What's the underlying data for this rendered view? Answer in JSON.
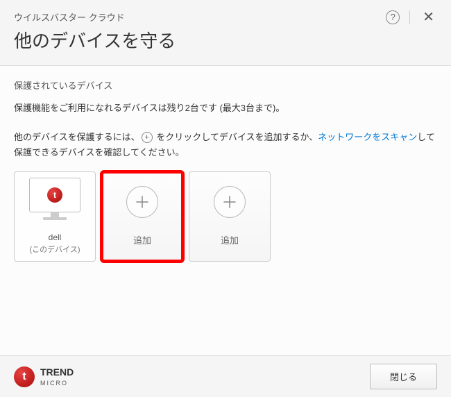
{
  "header": {
    "subtitle": "ウイルスバスター クラウド",
    "title": "他のデバイスを守る"
  },
  "content": {
    "sectionLabel": "保護されているデバイス",
    "infoText": "保護機能をご利用になれるデバイスは残り2台です (最大3台まで)。",
    "instruction": {
      "part1": "他のデバイスを保護するには、",
      "part2": " をクリックしてデバイスを追加するか、",
      "linkText": "ネットワークをスキャン",
      "part3": "して保護できるデバイスを確認してください。"
    }
  },
  "devices": {
    "current": {
      "name": "dell",
      "label": "(このデバイス)"
    },
    "addLabel": "追加"
  },
  "footer": {
    "brandName": "TREND",
    "brandSub": "MICRO",
    "closeLabel": "閉じる"
  }
}
